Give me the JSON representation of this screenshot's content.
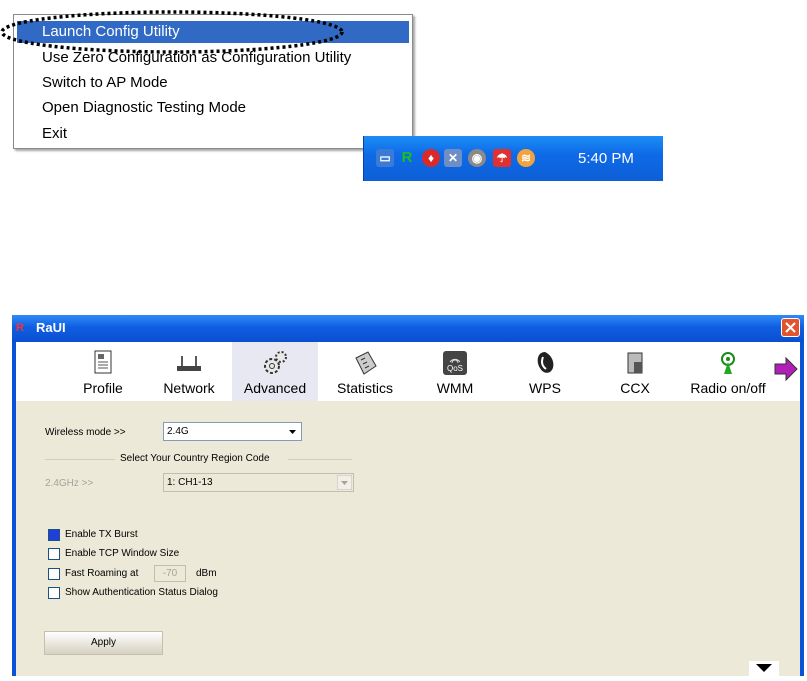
{
  "context_menu": {
    "items": [
      {
        "label": "Launch Config Utility"
      },
      {
        "label": "Use Zero Configuration as Configuration Utility"
      },
      {
        "label": "Switch to AP Mode"
      },
      {
        "label": "Open Diagnostic Testing Mode"
      },
      {
        "label": "Exit"
      }
    ]
  },
  "taskbar": {
    "clock": "5:40 PM",
    "tray_icons": [
      "network-icon",
      "app-r-icon",
      "shield-icon",
      "network-disconnected-icon",
      "speaker-icon",
      "antivirus-icon",
      "wireless-icon"
    ]
  },
  "window": {
    "title": "RaUI",
    "toolbar": [
      {
        "label": "Profile",
        "icon": "profile-icon"
      },
      {
        "label": "Network",
        "icon": "network-router-icon"
      },
      {
        "label": "Advanced",
        "icon": "gears-icon"
      },
      {
        "label": "Statistics",
        "icon": "calculator-icon"
      },
      {
        "label": "WMM",
        "icon": "qos-icon"
      },
      {
        "label": "WPS",
        "icon": "wps-icon"
      },
      {
        "label": "CCX",
        "icon": "ccx-icon"
      },
      {
        "label": "Radio on/off",
        "icon": "radio-icon"
      }
    ],
    "advanced": {
      "wireless_mode_label": "Wireless mode >>",
      "wireless_mode_value": "2.4G",
      "country_group_title": "Select Your Country Region Code",
      "band_label": "2.4GHz >>",
      "band_value": "1: CH1-13",
      "tx_burst_label": "Enable TX Burst",
      "tcp_window_label": "Enable TCP Window Size",
      "fast_roaming_label": "Fast Roaming at",
      "fast_roaming_value": "-70",
      "fast_roaming_unit": "dBm",
      "auth_dialog_label": "Show Authentication Status Dialog",
      "apply_label": "Apply"
    }
  },
  "colors": {
    "menu_highlight": "#316ac5",
    "taskbar_blue": "#0f5fe0",
    "panel_bg": "#ece9d8",
    "checked_box": "#1f3fd8"
  }
}
